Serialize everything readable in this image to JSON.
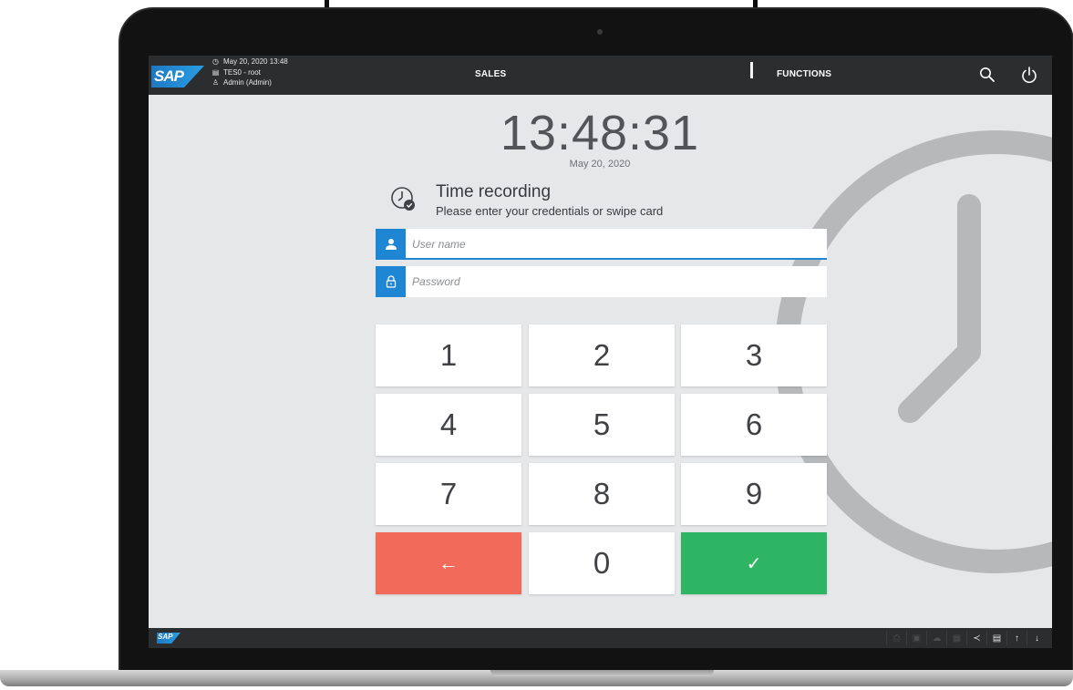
{
  "header": {
    "datetime": "May 20, 2020 13:48",
    "terminal": "TES0 - root",
    "user": "Admin (Admin)",
    "nav_sales": "SALES",
    "nav_functions": "FUNCTIONS",
    "logo_text": "SAP"
  },
  "clock": {
    "time": "13:48:31",
    "date": "May 20, 2020"
  },
  "time_recording": {
    "title": "Time recording",
    "subtitle": "Please enter your credentials or swipe card"
  },
  "form": {
    "username_placeholder": "User name",
    "username_value": "",
    "password_placeholder": "Password",
    "password_value": ""
  },
  "keypad": {
    "keys": [
      "1",
      "2",
      "3",
      "4",
      "5",
      "6",
      "7",
      "8",
      "9",
      "←",
      "0",
      "✓"
    ]
  },
  "footer": {
    "logo_text": "SAP",
    "icons": [
      "print-icon",
      "lock-icon",
      "cloud-icon",
      "grid-icon",
      "share-icon",
      "database-icon",
      "arrow-up-icon",
      "arrow-down-icon"
    ]
  },
  "colors": {
    "accent": "#1e86d2",
    "back_key": "#f26b5a",
    "ok_key": "#2eb564",
    "bar": "#2c2d2f",
    "screen_bg": "#e6e7e9"
  }
}
